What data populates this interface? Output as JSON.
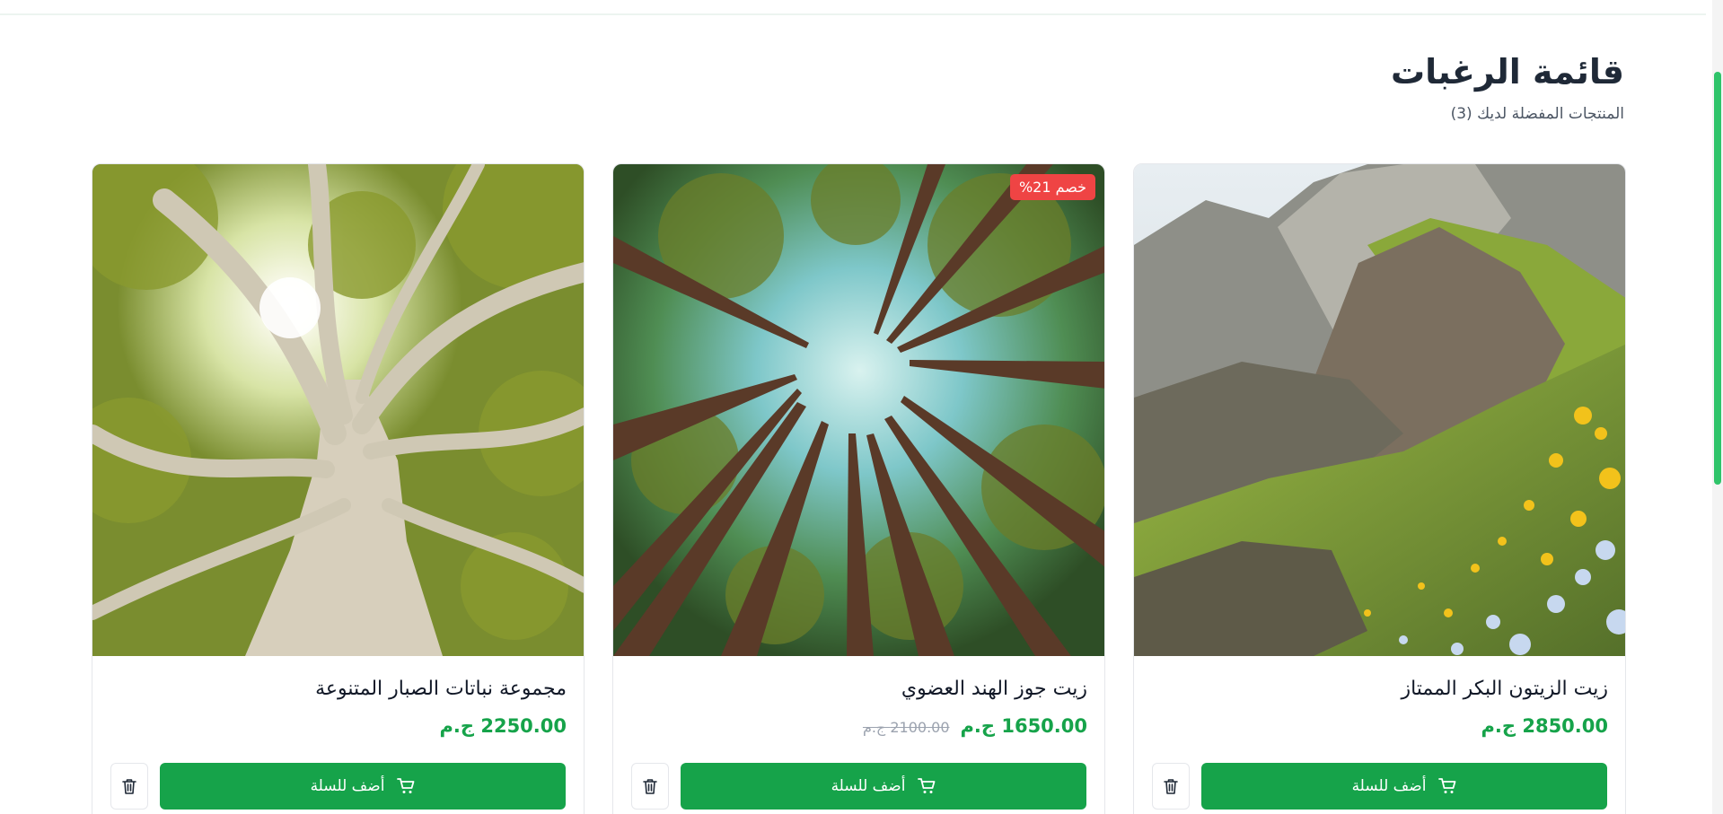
{
  "header": {
    "title": "قائمة الرغبات",
    "subtitle": "المنتجات المفضلة لديك (3)"
  },
  "products": [
    {
      "name": "زيت الزيتون البكر الممتاز",
      "price": "2850.00 ج.م",
      "image": "mountain meadow with yellow and blue wildflowers",
      "add_label": "أضف للسلة"
    },
    {
      "name": "زيت جوز الهند العضوي",
      "price": "1650.00 ج.م",
      "old_price": "2100.00 ج.م",
      "discount": "خصم 21%",
      "image": "looking up at tall forest trees",
      "add_label": "أضف للسلة"
    },
    {
      "name": "مجموعة نباتات الصبار المتنوعة",
      "price": "2250.00 ج.م",
      "image": "large tree with sun through branches",
      "add_label": "أضف للسلة"
    }
  ],
  "colors": {
    "accent": "#16a34a",
    "badge": "#ef4444",
    "scrollbar": "#2fc46a"
  },
  "icons": [
    "cart-icon",
    "trash-icon"
  ]
}
